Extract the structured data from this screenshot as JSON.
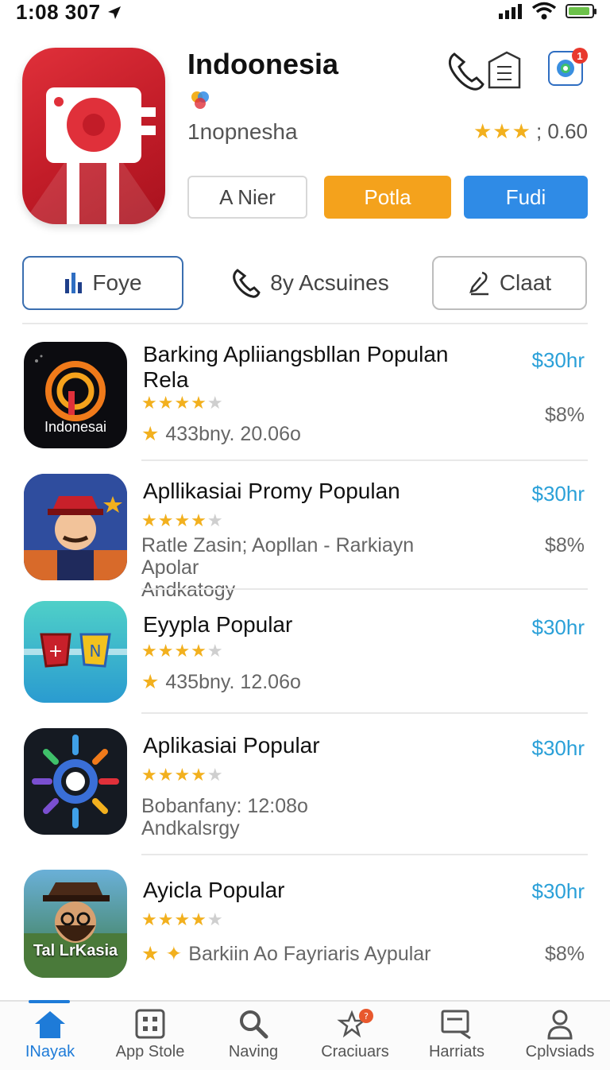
{
  "status_bar": {
    "time": "1:08 307"
  },
  "app": {
    "title": "Indoonesia",
    "subtitle": "1nopnesha",
    "rating_text": "; 0.60",
    "notification_count": "1",
    "buttons": {
      "outline": "A Nier",
      "orange": "Potla",
      "blue": "Fudi"
    }
  },
  "segments": [
    {
      "label": "Foye"
    },
    {
      "label": "8y Acsuines"
    },
    {
      "label": "Claat"
    }
  ],
  "list": [
    {
      "title": "Barking Apliiangsbllan Populan Rela",
      "meta": "433bny. 20.06o",
      "meta2": "",
      "price": "$30hr",
      "pct": "$8%",
      "icon_label": "Indonesai"
    },
    {
      "title": "Apllikasiai Promy Populan",
      "meta": "Ratle Zasin; Aopllan - Rarkiayn Apolar",
      "meta2": "Andkatogy",
      "price": "$30hr",
      "pct": "$8%",
      "icon_label": ""
    },
    {
      "title": "Eyypla Popular",
      "meta": "435bny. 12.06o",
      "meta2": "",
      "price": "$30hr",
      "pct": "",
      "icon_label": ""
    },
    {
      "title": "Aplikasiai Popular",
      "meta": "Bobanfany: 12:08o",
      "meta2": "Andkalsrgy",
      "price": "$30hr",
      "pct": "",
      "icon_label": ""
    },
    {
      "title": "Ayicla Popular",
      "meta": "Barkiin Ao Fayriaris Aypular",
      "meta2": "",
      "price": "$30hr",
      "pct": "$8%",
      "icon_label": "Tal LrKasia"
    }
  ],
  "tabbar": {
    "tabs": [
      {
        "label": "INayak",
        "icon": "home-icon",
        "active": true
      },
      {
        "label": "App Stole",
        "icon": "grid-icon",
        "active": false
      },
      {
        "label": "Naving",
        "icon": "search-icon",
        "active": false
      },
      {
        "label": "Craciuars",
        "icon": "star-badge-icon",
        "active": false
      },
      {
        "label": "Harriats",
        "icon": "chart-icon",
        "active": false
      },
      {
        "label": "Cplvsiads",
        "icon": "person-icon",
        "active": false
      }
    ]
  },
  "colors": {
    "accent": "#1e7bd8",
    "orange": "#f4a21c",
    "blue": "#2f8be6",
    "star": "#f2b01e",
    "price": "#2aa0d8"
  }
}
